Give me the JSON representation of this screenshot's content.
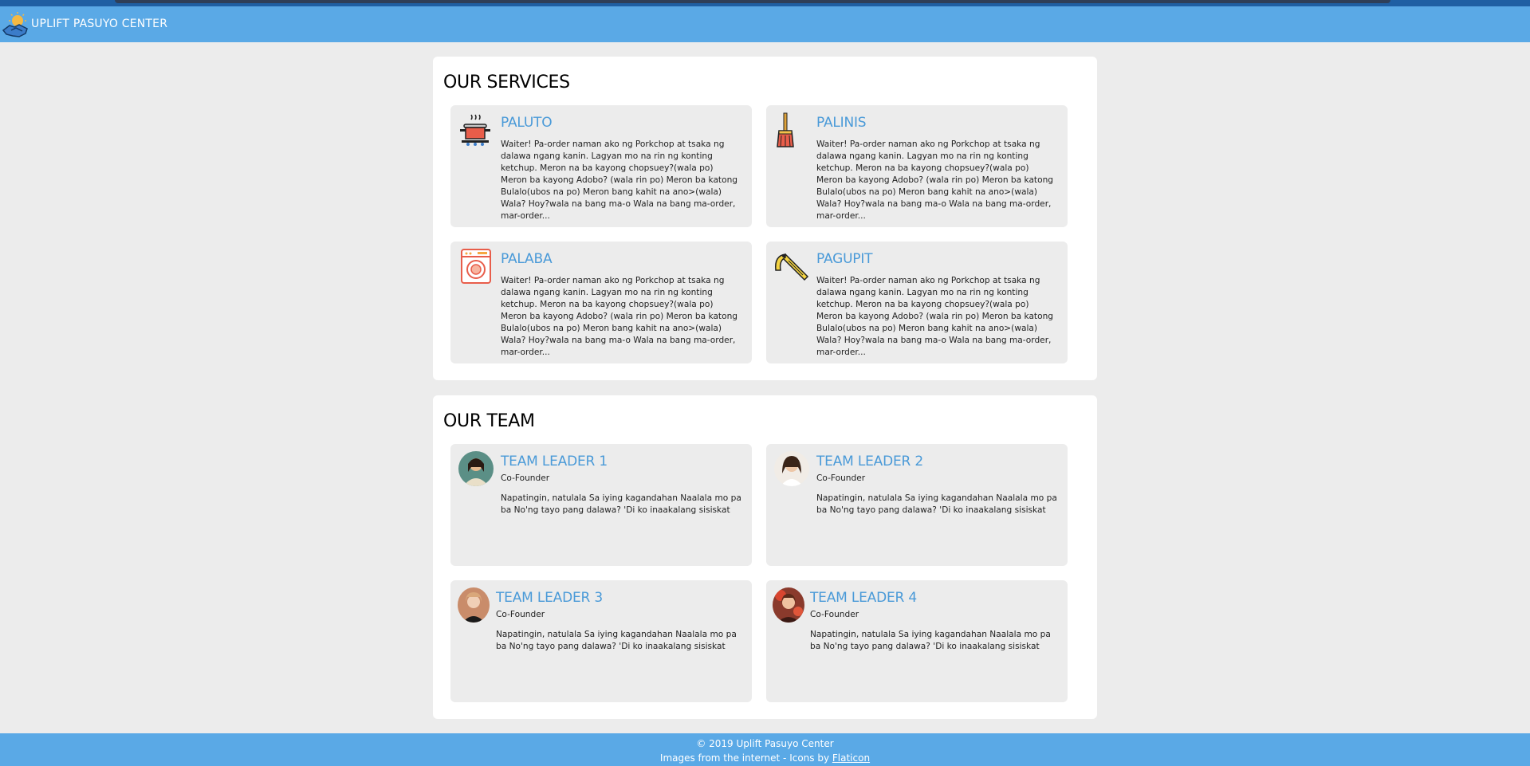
{
  "header": {
    "title": "UPLIFT PASUYO CENTER",
    "logo_icon": "handshake-sun-icon"
  },
  "services": {
    "heading": "OUR SERVICES",
    "items": [
      {
        "title": "PALUTO",
        "icon": "cooking-pot-icon",
        "text": "Waiter! Pa-order naman ako ng Porkchop at tsaka ng dalawa ngang kanin. Lagyan mo na rin ng konting ketchup. Meron na ba kayong chopsuey?(wala po) Meron ba kayong Adobo? (wala rin po) Meron ba katong Bulalo(ubos na po) Meron bang kahit na ano>(wala) Wala? Hoy?wala na bang ma-o Wala na bang ma-order, mar-order..."
      },
      {
        "title": "PALINIS",
        "icon": "broom-icon",
        "text": "Waiter! Pa-order naman ako ng Porkchop at tsaka ng dalawa ngang kanin. Lagyan mo na rin ng konting ketchup. Meron na ba kayong chopsuey?(wala po) Meron ba kayong Adobo? (wala rin po) Meron ba katong Bulalo(ubos na po) Meron bang kahit na ano>(wala) Wala? Hoy?wala na bang ma-o Wala na bang ma-order, mar-order..."
      },
      {
        "title": "PALABA",
        "icon": "washing-machine-icon",
        "text": "Waiter! Pa-order naman ako ng Porkchop at tsaka ng dalawa ngang kanin. Lagyan mo na rin ng konting ketchup. Meron na ba kayong chopsuey?(wala po) Meron ba kayong Adobo? (wala rin po) Meron ba katong Bulalo(ubos na po) Meron bang kahit na ano>(wala) Wala? Hoy?wala na bang ma-o Wala na bang ma-order, mar-order..."
      },
      {
        "title": "PAGUPIT",
        "icon": "razor-icon",
        "text": "Waiter! Pa-order naman ako ng Porkchop at tsaka ng dalawa ngang kanin. Lagyan mo na rin ng konting ketchup. Meron na ba kayong chopsuey?(wala po) Meron ba kayong Adobo? (wala rin po) Meron ba katong Bulalo(ubos na po) Meron bang kahit na ano>(wala) Wala? Hoy?wala na bang ma-o Wala na bang ma-order, mar-order..."
      }
    ]
  },
  "team": {
    "heading": "OUR TEAM",
    "members": [
      {
        "name": "TEAM LEADER 1",
        "role": "Co-Founder",
        "bio": "Napatingin, natulala Sa iying kagandahan Naalala mo pa ba No'ng tayo pang dalawa? 'Di ko inaakalang sisiskat"
      },
      {
        "name": "TEAM LEADER 2",
        "role": "Co-Founder",
        "bio": "Napatingin, natulala Sa iying kagandahan Naalala mo pa ba No'ng tayo pang dalawa? 'Di ko inaakalang sisiskat"
      },
      {
        "name": "TEAM LEADER 3",
        "role": "Co-Founder",
        "bio": "Napatingin, natulala Sa iying kagandahan Naalala mo pa ba No'ng tayo pang dalawa? 'Di ko inaakalang sisiskat"
      },
      {
        "name": "TEAM LEADER 4",
        "role": "Co-Founder",
        "bio": "Napatingin, natulala Sa iying kagandahan Naalala mo pa ba No'ng tayo pang dalawa? 'Di ko inaakalang sisiskat"
      }
    ]
  },
  "footer": {
    "copyright": "© 2019 Uplift Pasuyo Center",
    "credits_prefix": "Images from the internet - Icons by ",
    "credits_link": "Flaticon"
  },
  "colors": {
    "header_bg": "#5aa9e6",
    "accent_title": "#4a9ad8",
    "page_bg": "#ececec",
    "card_bg": "#ececec"
  }
}
